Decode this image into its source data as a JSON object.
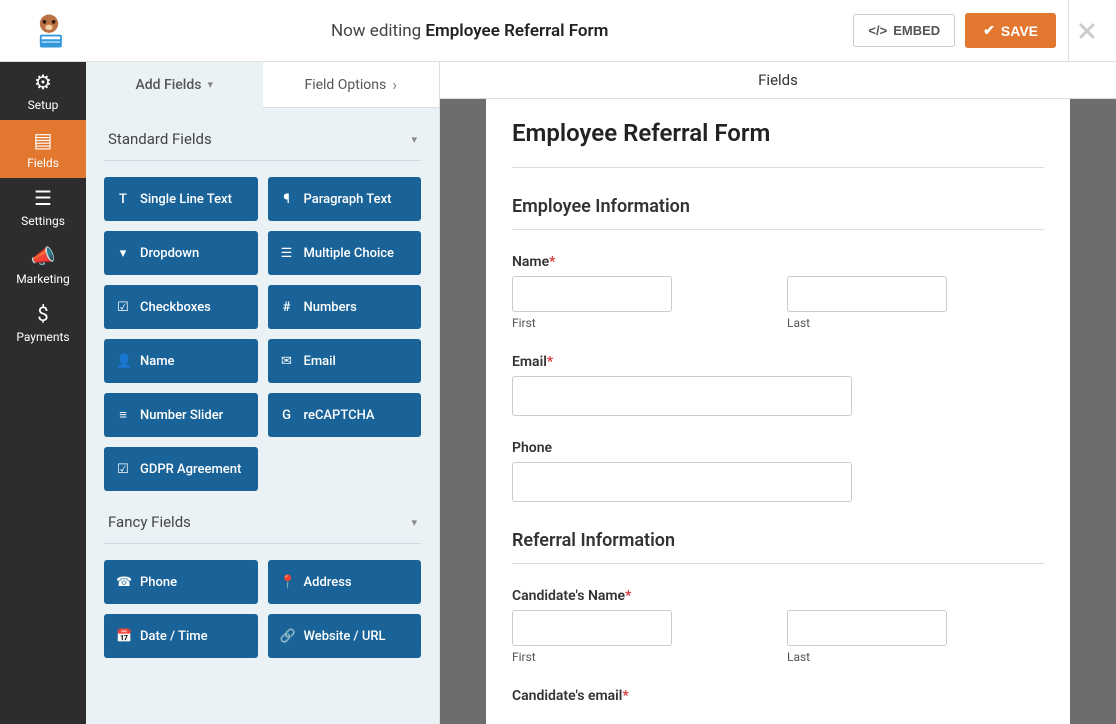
{
  "header": {
    "now_editing_prefix": "Now editing",
    "form_name": "Employee Referral Form",
    "embed": "EMBED",
    "save": "SAVE"
  },
  "leftnav": {
    "setup": "Setup",
    "fields": "Fields",
    "settings": "Settings",
    "marketing": "Marketing",
    "payments": "Payments"
  },
  "tabs": {
    "add_fields": "Add Fields",
    "field_options": "Field Options"
  },
  "sections": {
    "standard": "Standard Fields",
    "fancy": "Fancy Fields"
  },
  "standard_fields": {
    "single_line": "Single Line Text",
    "paragraph": "Paragraph Text",
    "dropdown": "Dropdown",
    "multiple_choice": "Multiple Choice",
    "checkboxes": "Checkboxes",
    "numbers": "Numbers",
    "name": "Name",
    "email": "Email",
    "slider": "Number Slider",
    "recaptcha": "reCAPTCHA",
    "gdpr": "GDPR Agreement"
  },
  "fancy_fields": {
    "phone": "Phone",
    "address": "Address",
    "datetime": "Date / Time",
    "website": "Website / URL"
  },
  "preview": {
    "tab_label": "Fields",
    "form_title": "Employee Referral Form",
    "section1": "Employee Information",
    "section2": "Referral Information",
    "name_label": "Name",
    "email_label": "Email",
    "phone_label": "Phone",
    "first": "First",
    "last": "Last",
    "cand_name": "Candidate's Name",
    "cand_email": "Candidate's email"
  }
}
